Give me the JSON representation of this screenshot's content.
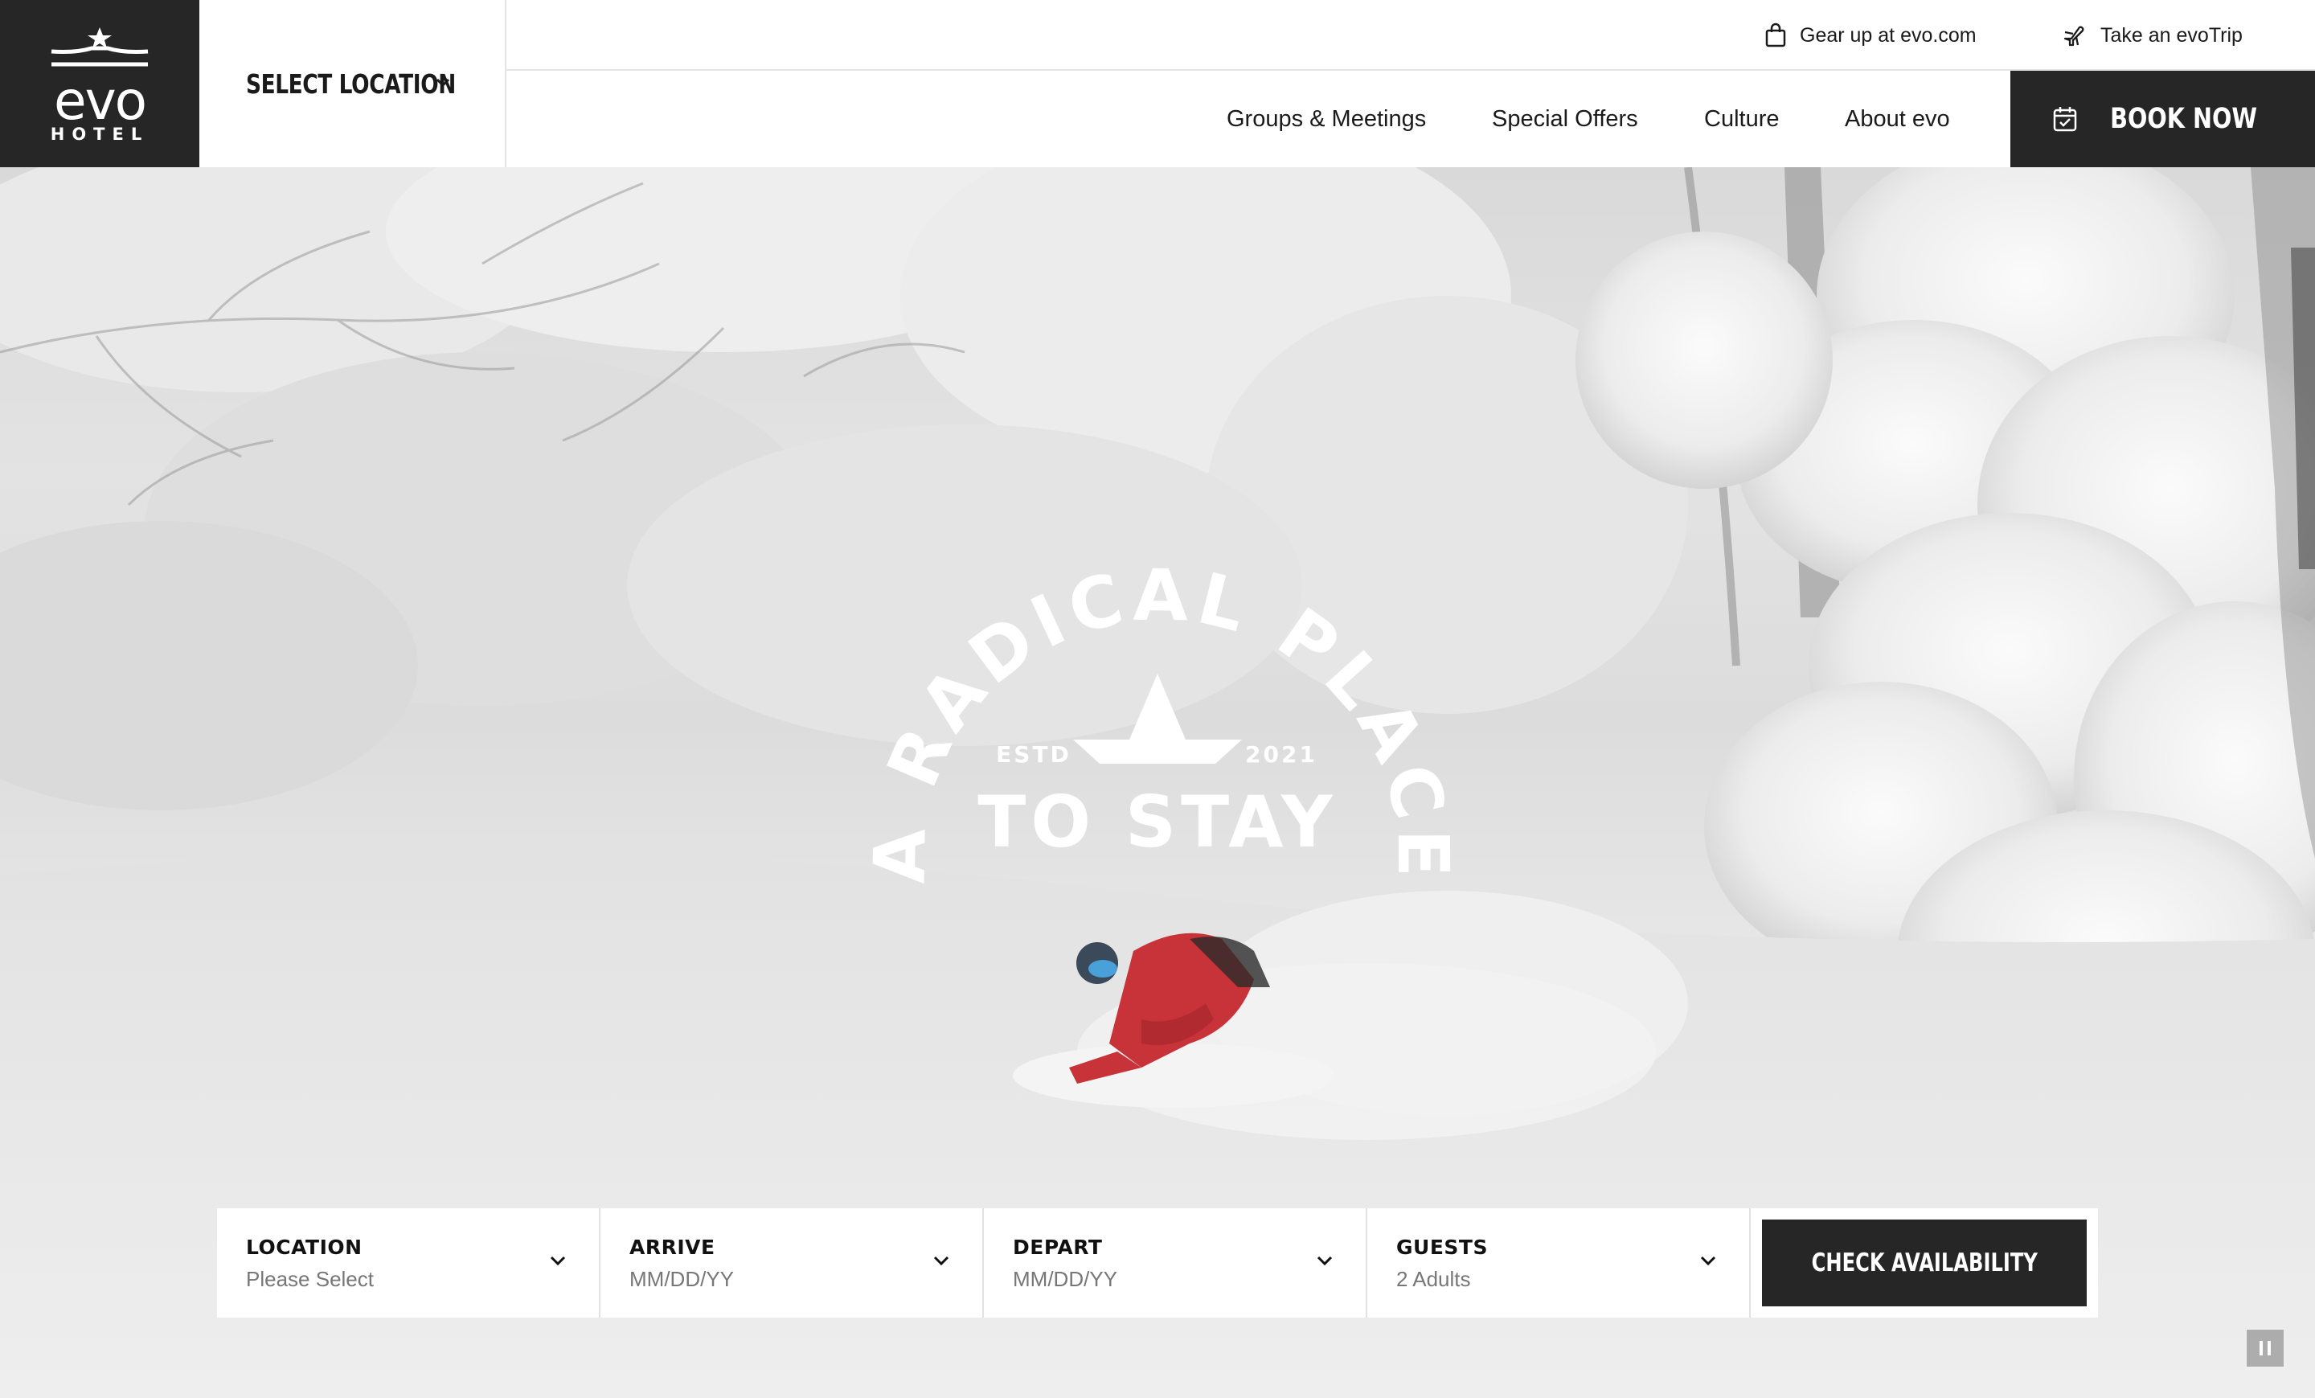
{
  "brand": {
    "logo_word": "evo",
    "logo_sub": "HOTEL"
  },
  "header": {
    "location_select": "SELECT LOCATION",
    "utility_links": {
      "gear": "Gear up at evo.com",
      "trip": "Take an evoTrip"
    },
    "nav": [
      "Groups & Meetings",
      "Special Offers",
      "Culture",
      "About evo"
    ],
    "book_now": "BOOK NOW"
  },
  "hero": {
    "badge": {
      "arc_text": "A RADICAL PLACE",
      "main_text": "TO STAY",
      "estd": "ESTD",
      "year": "2021"
    }
  },
  "booking": {
    "fields": [
      {
        "label": "LOCATION",
        "value": "Please Select"
      },
      {
        "label": "ARRIVE",
        "value": "MM/DD/YY"
      },
      {
        "label": "DEPART",
        "value": "MM/DD/YY"
      },
      {
        "label": "GUESTS",
        "value": "2 Adults"
      }
    ],
    "submit": "CHECK AVAILABILITY"
  },
  "icons": {
    "gear": "shopping-bag-icon",
    "trip": "airplane-icon",
    "book": "calendar-icon",
    "chevron": "chevron-down-icon",
    "pause": "pause-icon"
  },
  "colors": {
    "dark": "#262626",
    "white": "#ffffff",
    "snowfall": "#e3e3e3",
    "rider_jacket": "#c8333a"
  }
}
